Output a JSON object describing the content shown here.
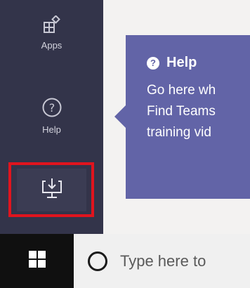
{
  "sidebar": {
    "apps": {
      "label": "Apps",
      "icon": "apps-icon"
    },
    "help": {
      "label": "Help",
      "icon": "help-circle-icon"
    },
    "download": {
      "icon": "download-monitor-icon",
      "highlight_color": "#e0141e"
    }
  },
  "callout": {
    "title": "Help",
    "lines": [
      "Go here wh",
      "Find Teams",
      "training vid"
    ],
    "color": "#6264a7"
  },
  "taskbar": {
    "start_icon": "windows-logo-icon",
    "search_placeholder": "Type here to"
  }
}
